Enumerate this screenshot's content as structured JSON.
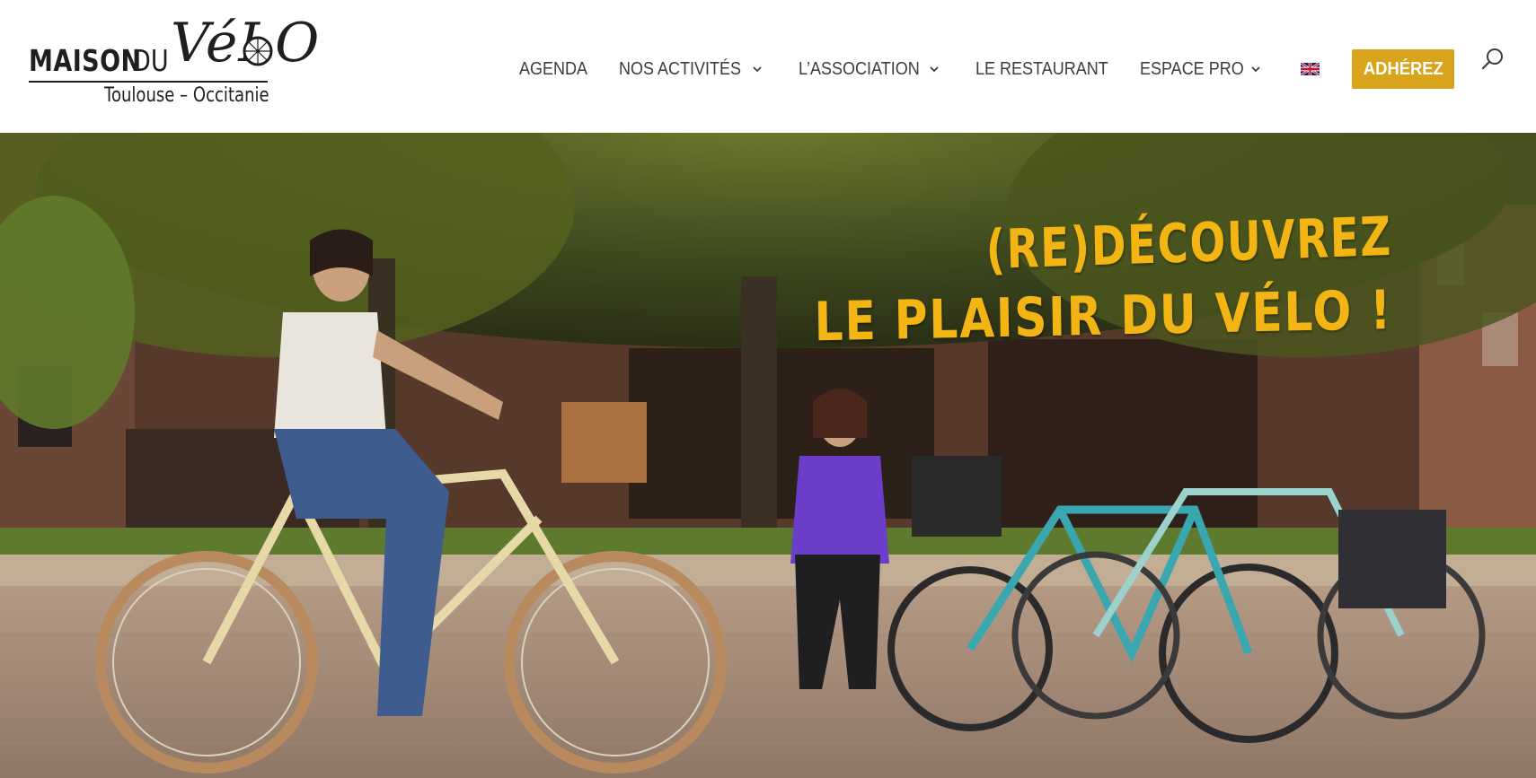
{
  "brand": {
    "logo_line1_a": "MAISON",
    "logo_line1_b": "DU",
    "logo_velo": "VéLO",
    "logo_subtitle": "Toulouse – Occitanie",
    "accent_color": "#d9a41c"
  },
  "nav": {
    "items": [
      {
        "label": "AGENDA",
        "has_dropdown": false
      },
      {
        "label": "NOS ACTIVITÉS",
        "has_dropdown": true
      },
      {
        "label": "L’ASSOCIATION",
        "has_dropdown": true
      },
      {
        "label": "LE RESTAURANT",
        "has_dropdown": false
      },
      {
        "label": "ESPACE PRO",
        "has_dropdown": true
      }
    ],
    "language_icon": "uk-flag-icon",
    "cta_label": "ADHÉREZ",
    "search_icon": "search-icon"
  },
  "hero": {
    "headline_line1": "(RE)DÉCOUVREZ",
    "headline_line2": "LE PLAISIR DU VÉLO !",
    "headline_color": "#f2b514"
  }
}
